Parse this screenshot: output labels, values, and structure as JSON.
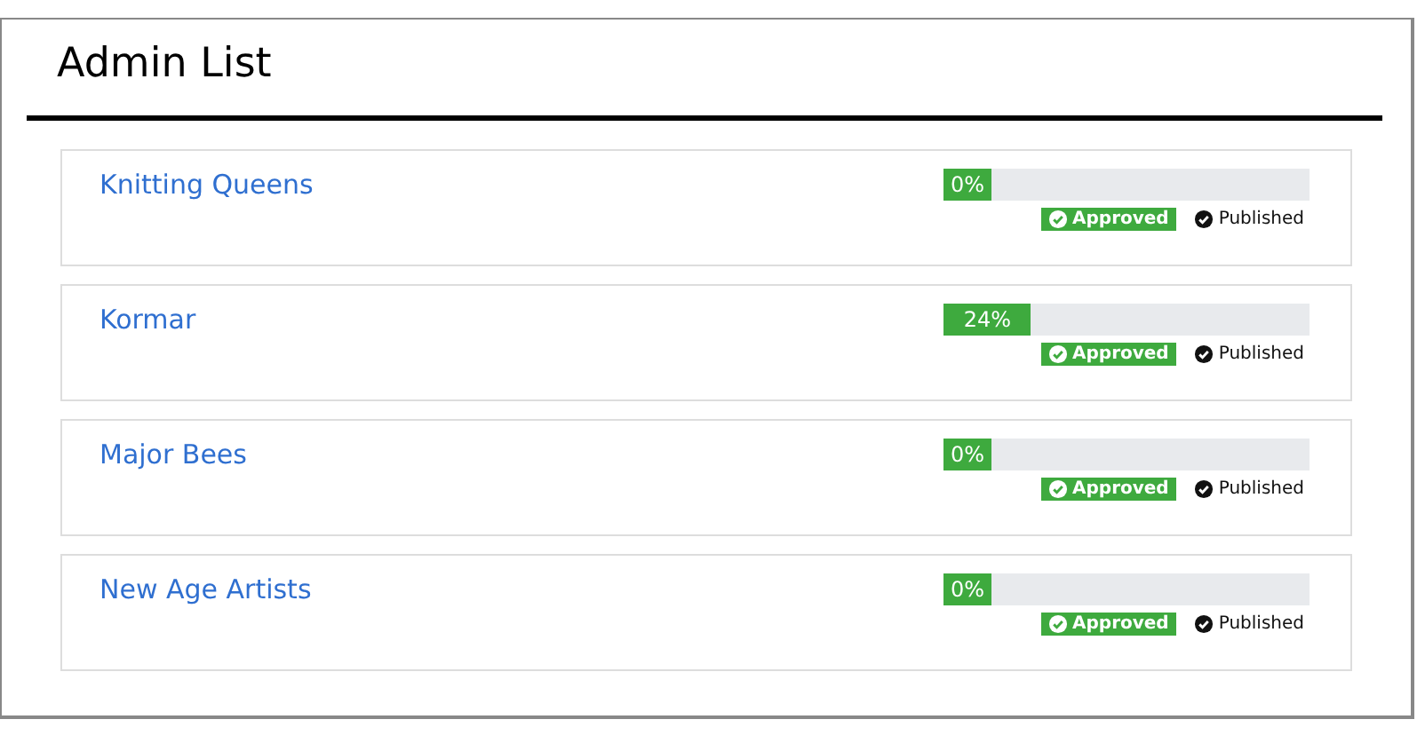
{
  "title": "Admin List",
  "items": [
    {
      "name": "Knitting Queens",
      "level": 0,
      "reading": "0%",
      "approved": true,
      "approved_label": "Approved",
      "published": true,
      "published_label": "Published"
    },
    {
      "name": "Kormar",
      "level": 0.24,
      "reading": "24%",
      "approved": true,
      "approved_label": "Approved",
      "published": true,
      "published_label": "Published"
    },
    {
      "name": "Major Bees",
      "level": 0,
      "reading": "0%",
      "approved": true,
      "approved_label": "Approved",
      "published": true,
      "published_label": "Published"
    },
    {
      "name": "New Age Artists",
      "level": 0,
      "reading": "0%",
      "approved": true,
      "approved_label": "Approved",
      "published": true,
      "published_label": "Published"
    }
  ]
}
